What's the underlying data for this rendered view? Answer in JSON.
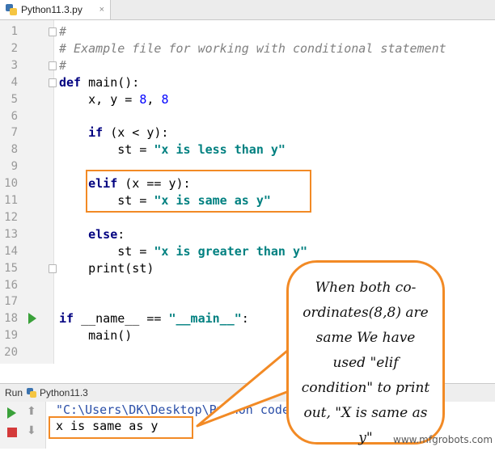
{
  "tab": {
    "title": "Python11.3.py",
    "close": "×",
    "icon": "python-file-icon"
  },
  "editor": {
    "lines": [
      {
        "n": "1",
        "tokens": [
          {
            "t": "#",
            "c": "cmt"
          }
        ]
      },
      {
        "n": "2",
        "tokens": [
          {
            "t": "# Example file for working with conditional statement",
            "c": "cmt"
          }
        ]
      },
      {
        "n": "3",
        "tokens": [
          {
            "t": "#",
            "c": "cmt"
          }
        ]
      },
      {
        "n": "4",
        "tokens": [
          {
            "t": "def",
            "c": "kw"
          },
          {
            "t": " main():",
            "c": ""
          }
        ]
      },
      {
        "n": "5",
        "tokens": [
          {
            "t": "    x, y = ",
            "c": ""
          },
          {
            "t": "8",
            "c": "num"
          },
          {
            "t": ", ",
            "c": ""
          },
          {
            "t": "8",
            "c": "num"
          }
        ]
      },
      {
        "n": "6",
        "tokens": []
      },
      {
        "n": "7",
        "tokens": [
          {
            "t": "    ",
            "c": ""
          },
          {
            "t": "if",
            "c": "kw"
          },
          {
            "t": " (x < y):",
            "c": ""
          }
        ]
      },
      {
        "n": "8",
        "tokens": [
          {
            "t": "        st = ",
            "c": ""
          },
          {
            "t": "\"x is less than y\"",
            "c": "str"
          }
        ]
      },
      {
        "n": "9",
        "tokens": []
      },
      {
        "n": "10",
        "tokens": [
          {
            "t": "    ",
            "c": ""
          },
          {
            "t": "elif",
            "c": "kw"
          },
          {
            "t": " (x == y):",
            "c": ""
          }
        ]
      },
      {
        "n": "11",
        "tokens": [
          {
            "t": "        st = ",
            "c": ""
          },
          {
            "t": "\"x is same as y\"",
            "c": "str"
          }
        ]
      },
      {
        "n": "12",
        "tokens": []
      },
      {
        "n": "13",
        "tokens": [
          {
            "t": "    ",
            "c": ""
          },
          {
            "t": "else",
            "c": "kw"
          },
          {
            "t": ":",
            "c": ""
          }
        ]
      },
      {
        "n": "14",
        "tokens": [
          {
            "t": "        st = ",
            "c": ""
          },
          {
            "t": "\"x is greater than y\"",
            "c": "str"
          }
        ]
      },
      {
        "n": "15",
        "tokens": [
          {
            "t": "    print(st)",
            "c": ""
          }
        ]
      },
      {
        "n": "16",
        "tokens": []
      },
      {
        "n": "17",
        "tokens": []
      },
      {
        "n": "18",
        "tokens": [
          {
            "t": "if",
            "c": "kw"
          },
          {
            "t": " __name__ == ",
            "c": ""
          },
          {
            "t": "\"__main__\"",
            "c": "str"
          },
          {
            "t": ":",
            "c": ""
          }
        ]
      },
      {
        "n": "19",
        "tokens": [
          {
            "t": "    main()",
            "c": ""
          }
        ]
      },
      {
        "n": "20",
        "tokens": []
      }
    ]
  },
  "run": {
    "label": "Run",
    "config": "Python11.3",
    "config_icon": "python-file-icon",
    "output_lines": [
      "\"C:\\Users\\DK\\Desktop\\Python code\\Python 11",
      "x is same as y"
    ]
  },
  "annotation": {
    "text": "When both co-ordinates(8,8) are same We have used \"elif condition\" to print out, \"X is same as y\""
  },
  "watermark": "www.mfgrobots.com",
  "colors": {
    "accent": "#f28a25",
    "keyword": "#000080",
    "string": "#008080",
    "number": "#0000ff",
    "comment": "#808080"
  }
}
